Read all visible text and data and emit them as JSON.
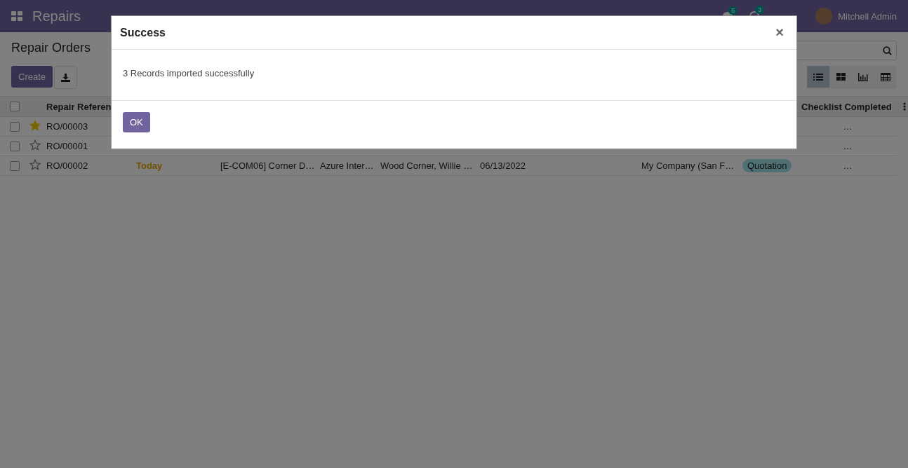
{
  "navbar": {
    "app_name": "Repairs",
    "messages_count": "5",
    "activities_count": "3",
    "user": "Mitchell Admin"
  },
  "control_panel": {
    "title": "Repair Orders",
    "create_button": "Create",
    "views": [
      {
        "kind": "list",
        "selected": true
      },
      {
        "kind": "kanban",
        "selected": false
      },
      {
        "kind": "graph",
        "selected": false
      },
      {
        "kind": "pivot",
        "selected": false
      }
    ]
  },
  "table": {
    "select_all_checked": false,
    "columns": [
      "Repair Referen",
      "",
      "",
      "",
      "",
      "",
      "",
      "",
      "Checklist Completed"
    ],
    "rows": [
      {
        "checked": false,
        "starred": true,
        "reference": "RO/00003",
        "checklist": "…"
      },
      {
        "checked": false,
        "starred": false,
        "reference": "RO/00001",
        "checklist": "…"
      },
      {
        "checked": false,
        "starred": false,
        "reference": "RO/00002",
        "scheduled": "Today",
        "product": "[E-COM06] Corner D…",
        "customer": "Azure Inter…",
        "address": "Wood Corner, Willie …",
        "date": "06/13/2022",
        "company": "My Company (San F…",
        "status": "Quotation",
        "checklist": "…"
      }
    ]
  },
  "dialog": {
    "title": "Success",
    "close_symbol": "×",
    "message": "3 Records imported successfully",
    "ok_button": "OK"
  }
}
